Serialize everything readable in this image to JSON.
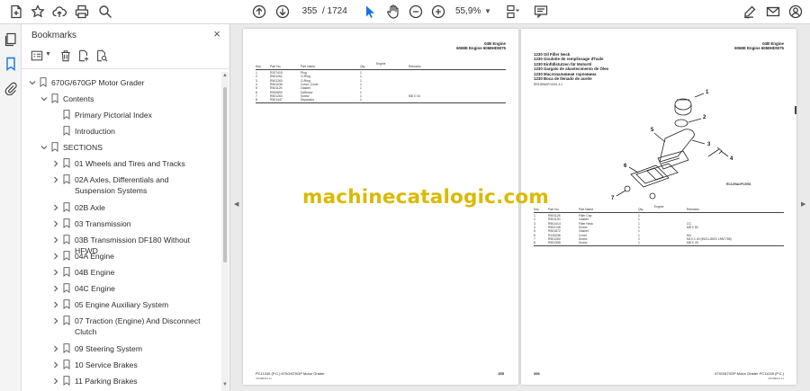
{
  "toolbar": {
    "left_icons": [
      "new-document-icon",
      "bookmark-star-icon",
      "cloud-upload-icon",
      "print-icon",
      "search-icon"
    ],
    "current_page": "355",
    "total_pages": "/ 1724",
    "zoom": "55,9%",
    "right_icons": [
      "edit-sign-icon",
      "email-icon",
      "profile-icon"
    ]
  },
  "panel": {
    "title": "Bookmarks",
    "close": "×"
  },
  "tree": [
    {
      "label": "670G/670GP Motor Grader",
      "depth": 0,
      "expanded": true
    },
    {
      "label": "Contents",
      "depth": 1,
      "expanded": true
    },
    {
      "label": "Primary Pictorial Index",
      "depth": 2,
      "leaf": true
    },
    {
      "label": "Introduction",
      "depth": 2,
      "leaf": true
    },
    {
      "label": "SECTIONS",
      "depth": 1,
      "expanded": true
    },
    {
      "label": "01 Wheels and Tires and Tracks",
      "depth": 2
    },
    {
      "label": "02A Axles, Differentials and Suspension Systems",
      "depth": 2
    },
    {
      "label": "02B Axle",
      "depth": 2
    },
    {
      "label": "03 Transmission",
      "depth": 2
    },
    {
      "label": "03B Transmission DF180 Without HFWD",
      "depth": 2
    },
    {
      "label": "04A Engine",
      "depth": 2
    },
    {
      "label": "04B Engine",
      "depth": 2
    },
    {
      "label": "04C Engine",
      "depth": 2
    },
    {
      "label": "05 Engine Auxiliary System",
      "depth": 2
    },
    {
      "label": "07 Traction (Engine) And Disconnect Clutch",
      "depth": 2
    },
    {
      "label": "09 Steering System",
      "depth": 2
    },
    {
      "label": "10 Service Brakes",
      "depth": 2
    },
    {
      "label": "11 Parking Brakes",
      "depth": 2
    }
  ],
  "left_page": {
    "header_line1": "04B Engine",
    "header_line2": "6068E Engine 6068HDW75",
    "table_header": [
      "Key",
      "Part No.",
      "Part Name",
      "Qty.",
      "Engine",
      "Remarks"
    ],
    "rows": [
      [
        "1",
        "R207415",
        "Plug",
        "1",
        "",
        ""
      ],
      [
        "2",
        "R501262",
        "O-Ring",
        "1",
        "",
        ""
      ],
      [
        "3",
        "R501263",
        "O-Ring",
        "1",
        "",
        ""
      ],
      [
        "4",
        "R501036",
        "Cover, Cover",
        "1",
        "",
        ""
      ],
      [
        "5",
        "R501126",
        "Gasket",
        "1",
        "",
        ""
      ],
      [
        "6",
        "R500890",
        "Deflector",
        "1",
        "",
        ""
      ],
      [
        "7",
        "R501264",
        "Screw",
        "1",
        "",
        "M8 X 16"
      ],
      [
        "8",
        "R501447",
        "Separator",
        "1",
        "",
        ""
      ]
    ],
    "footer_left": "PC11245   (P.C.)      670G/670GP Motor Grader",
    "footer_page": "355",
    "footer_sub": "470480XA 11"
  },
  "right_page": {
    "header_line1": "04B Engine",
    "header_line2": "6068E Engine 6068HDW75",
    "titles": [
      "1230 Oil Filler Neck",
      "1230 Goulotte de remplissage d'huile",
      "1230 Einfüllstutzen für Motoröl",
      "1230 Gargalo de abastecimento de Óleo",
      "1230 Маслозаливная горловина",
      "1230 Boca de llenado de aceite"
    ],
    "ref_code": "RE51894#PC0001 4-1",
    "callouts": [
      "1",
      "2",
      "3",
      "4",
      "5",
      "6",
      "7"
    ],
    "figure_code": "RC3-ENA#PC2951",
    "table_header": [
      "Key",
      "Part No.",
      "Part Name",
      "Qty.",
      "Engine",
      "Remarks"
    ],
    "rows": [
      [
        "1",
        "R501128",
        "Filler Cap",
        "1",
        "",
        ""
      ],
      [
        "2",
        "R501130",
        "Gasket",
        "1",
        "",
        ""
      ],
      [
        "3",
        "R501414",
        "Filler Neck",
        "1",
        "",
        "CC"
      ],
      [
        "4",
        "R502148",
        "Screw",
        "1",
        "",
        "M8 X 50"
      ],
      [
        "5",
        "R501672",
        "Gasket",
        "1",
        "",
        ""
      ],
      [
        "6",
        "R133236",
        "Cover",
        "1",
        "",
        "M4"
      ],
      [
        "7",
        "R501260",
        "Screw",
        "2",
        "",
        "M10 X 40 (INCLUDED 19N7785)"
      ],
      [
        "8",
        "R501355",
        "Screw",
        "1",
        "",
        "M8 X 40"
      ]
    ],
    "footer_page": "356",
    "footer_right": "670G/670GP Motor Grader   PC11245   (P.C.)",
    "footer_sub": "470480XA 11"
  },
  "watermark": "machinecatalogic.com",
  "colors": {
    "accent": "#1473e6",
    "bookmark_icon": "#555555",
    "watermark": "#d9ba00"
  }
}
